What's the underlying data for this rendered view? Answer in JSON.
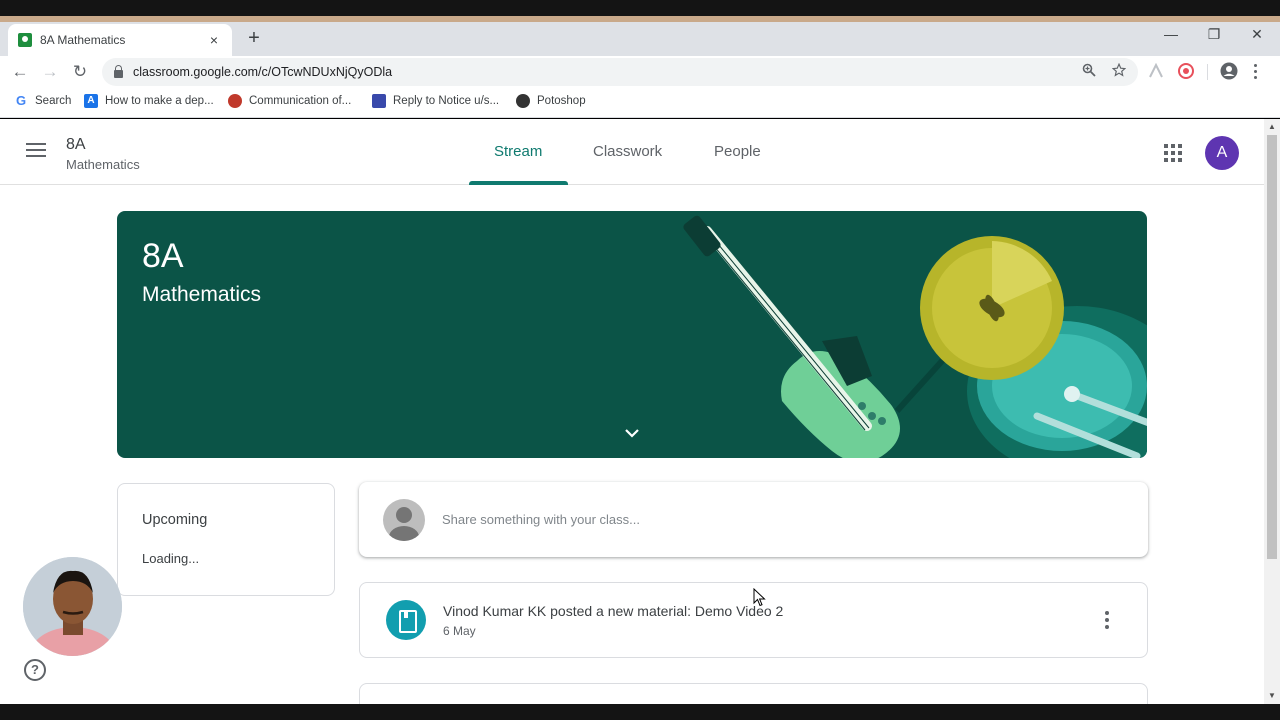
{
  "browser": {
    "tab_title": "8A Mathematics",
    "tab_close": "×",
    "new_tab": "+",
    "url": "classroom.google.com/c/OTcwNDUxNjQyODla",
    "minimize": "—",
    "restore": "❐",
    "close": "✕",
    "bookmarks": [
      {
        "label": "Search",
        "icon": "google-icon",
        "color": "#4285f4"
      },
      {
        "label": "How to make a dep...",
        "icon": "a-logo-icon",
        "color": "#1a73e8"
      },
      {
        "label": "Communication of...",
        "icon": "globe-icon",
        "color": "#c0392b"
      },
      {
        "label": "Reply to Notice u/s...",
        "icon": "document-icon",
        "color": "#3949ab"
      },
      {
        "label": "Potoshop",
        "icon": "circle-icon",
        "color": "#333333"
      }
    ]
  },
  "header": {
    "class_name": "8A",
    "subject": "Mathematics",
    "tabs": [
      {
        "label": "Stream",
        "active": true
      },
      {
        "label": "Classwork",
        "active": false
      },
      {
        "label": "People",
        "active": false
      }
    ],
    "avatar_letter": "A",
    "avatar_color": "#5e35b1",
    "accent": "#0f7a6f"
  },
  "banner": {
    "title": "8A",
    "subtitle": "Mathematics",
    "color": "#0b5447"
  },
  "upcoming": {
    "title": "Upcoming",
    "status": "Loading..."
  },
  "share": {
    "placeholder": "Share something with your class..."
  },
  "posts": [
    {
      "title": "Vinod Kumar KK posted a new material: Demo Video 2",
      "date": "6 May",
      "icon": "material-icon"
    }
  ],
  "help": "?"
}
